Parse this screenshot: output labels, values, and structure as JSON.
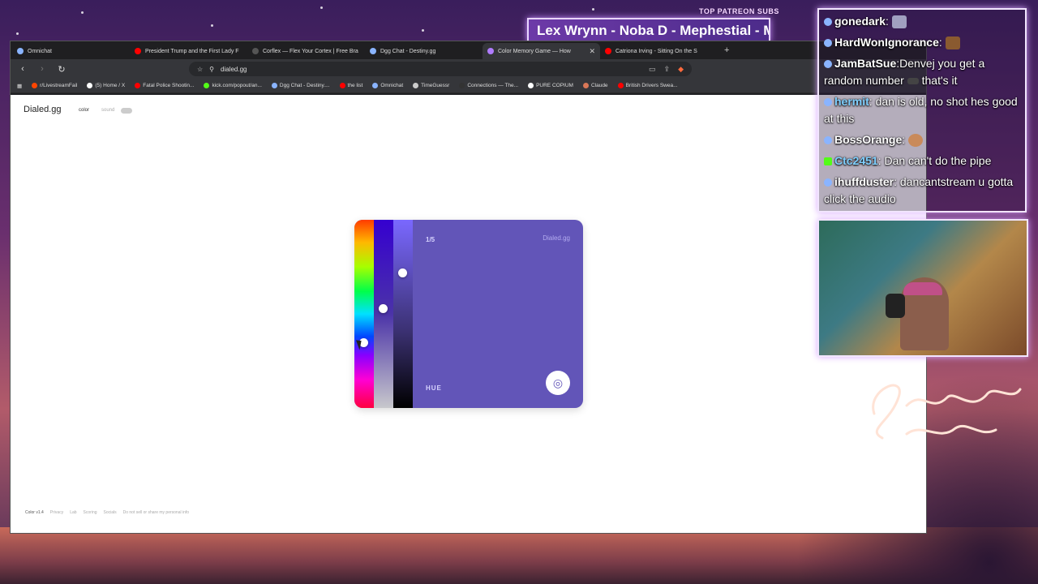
{
  "stream": {
    "top_subs_title": "TOP PATREON SUBS",
    "top_subs_ticker": "Lex Wrynn -  Noba D - Mephestial - M"
  },
  "browser": {
    "tabs": [
      {
        "label": "Omnichat",
        "color": "#8ab4ff"
      },
      {
        "label": "President Trump and the First Lady F",
        "color": "#ff0000"
      },
      {
        "label": "Corflex — Flex Your Cortex | Free Bra",
        "color": "#555555"
      },
      {
        "label": "Dgg Chat - Destiny.gg",
        "color": "#8ab4ff"
      },
      {
        "label": "Color Memory Game — How",
        "color": "#b07cff",
        "active": true
      },
      {
        "label": "Catriona Irving - Sitting On the S",
        "color": "#ff0000"
      }
    ],
    "new_tab": "+",
    "url": "dialed.gg",
    "bookmarks": [
      {
        "label": "r/LivestreamFail",
        "color": "#ff4500"
      },
      {
        "label": "(5) Home / X",
        "color": "#ffffff"
      },
      {
        "label": "Fatal Police Shootin...",
        "color": "#ff0000"
      },
      {
        "label": "kick.com/popout/an...",
        "color": "#53fc18"
      },
      {
        "label": "Dgg Chat - Destiny....",
        "color": "#8ab4ff"
      },
      {
        "label": "the list",
        "color": "#ff0000"
      },
      {
        "label": "Omnichat",
        "color": "#8ab4ff"
      },
      {
        "label": "TimeGuessr",
        "color": "#cccccc"
      },
      {
        "label": "Connections — The...",
        "color": "#333333"
      },
      {
        "label": "PURE COPIUM",
        "color": "#ffffff"
      },
      {
        "label": "Claude",
        "color": "#d97757"
      },
      {
        "label": "British Drivers Swea...",
        "color": "#ff0000"
      }
    ]
  },
  "site": {
    "logo": "Dialed.gg",
    "mode_color": "color",
    "mode_sound": "sound",
    "footer": [
      "Color v1.4",
      "Privacy",
      "Lab",
      "Scoring",
      "Socials",
      "Do not sell or share my personal info"
    ]
  },
  "game": {
    "round": "1/5",
    "brand": "Dialed.gg",
    "mode_label": "HUE",
    "bg_color": "#6255b8",
    "hue_level": 0.65,
    "saturation_level": 0.47,
    "brightness_level": 0.28
  },
  "chat": {
    "messages": [
      {
        "user": "gonedark",
        "text": "",
        "badge": "omni",
        "user_color": "#ffffff"
      },
      {
        "user": "HardWonIgnorance",
        "text": "",
        "badge": "omni",
        "user_color": "#ffffff"
      },
      {
        "user": "JamBatSue",
        "text": "Denvej you get a random number",
        "text2": "that's it",
        "badge": "omni",
        "user_color": "#ffffff"
      },
      {
        "user": "hermit",
        "text": "dan is old, no shot hes good at this",
        "badge": "omni",
        "user_color": "#7fd0ff"
      },
      {
        "user": "BossOrange",
        "text": "",
        "badge": "omni",
        "user_color": "#ffffff"
      },
      {
        "user": "Ctc2451",
        "text": "Dan can't do the pipe",
        "badge": "kick",
        "user_color": "#7fd0ff"
      },
      {
        "user": "ihuffduster",
        "text": "dancantstream u gotta click the audio",
        "badge": "omni",
        "user_color": "#ffffff"
      }
    ]
  }
}
